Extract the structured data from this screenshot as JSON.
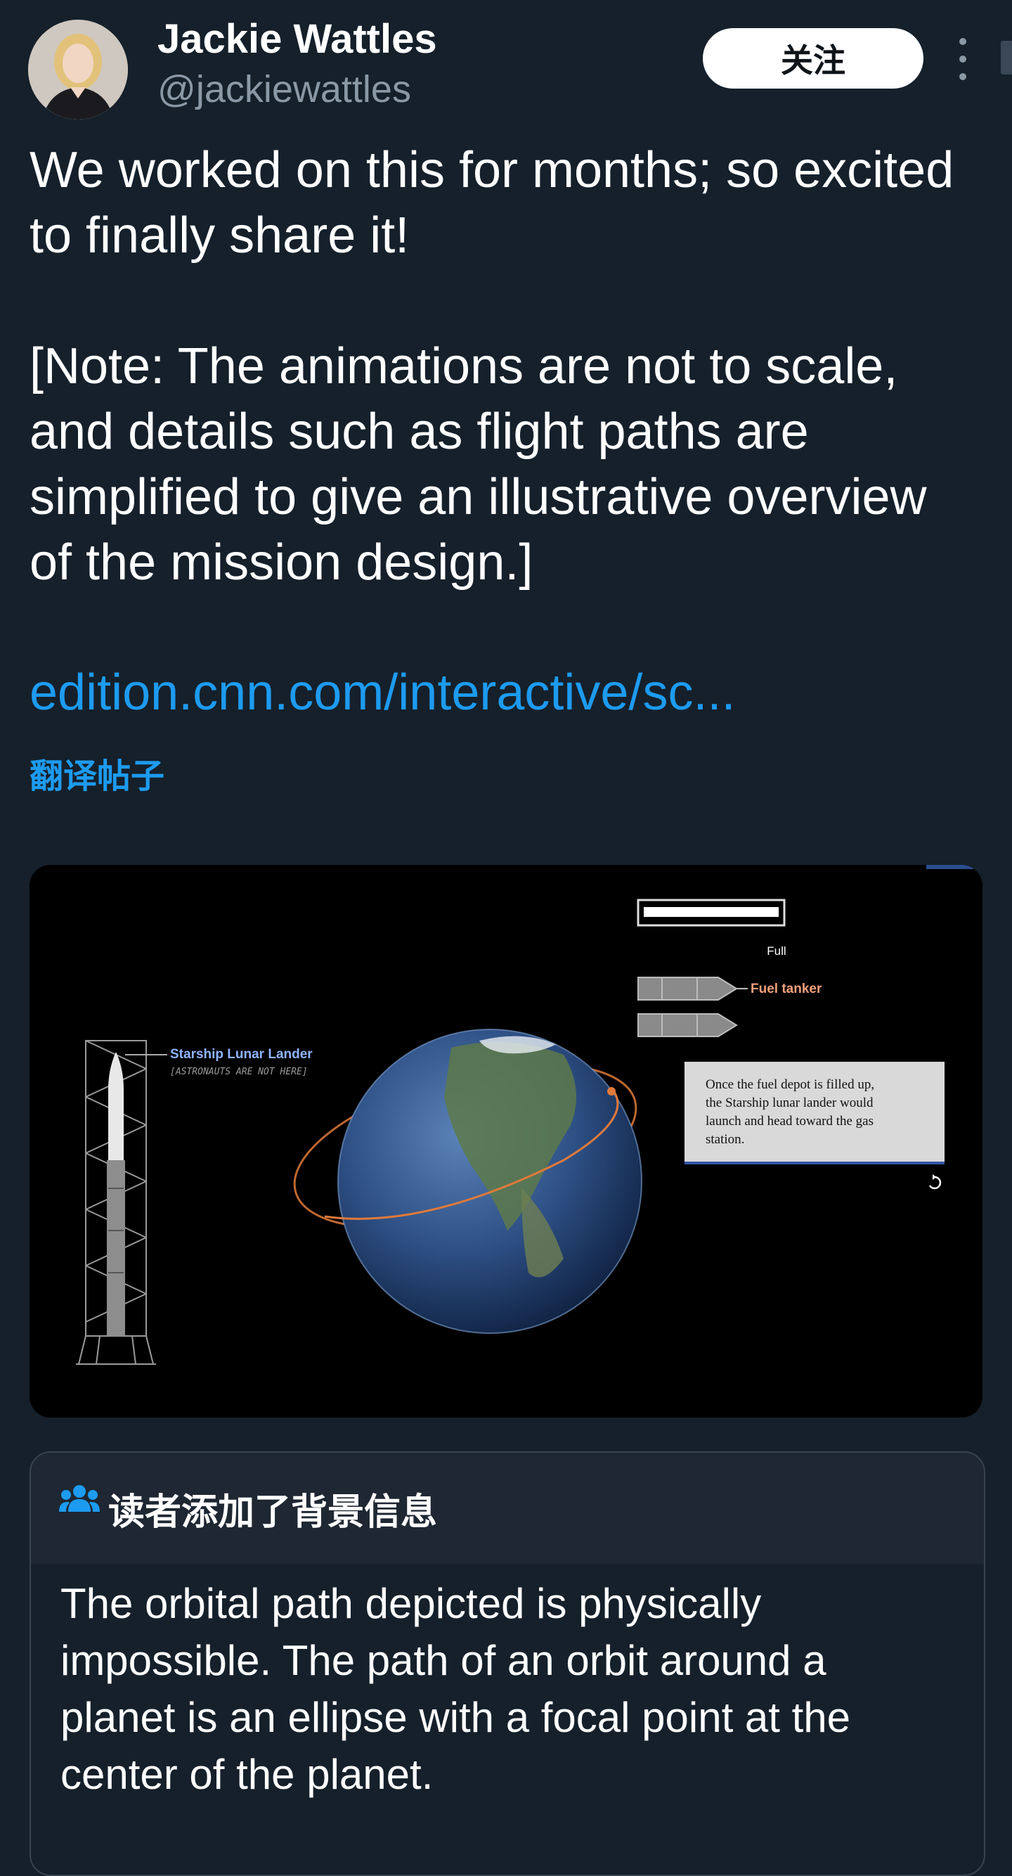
{
  "author": {
    "name": "Jackie Wattles",
    "handle": "@jackiewattles"
  },
  "follow_label": "关注",
  "tweet": {
    "lines": [
      "We worked on this for months; so excited",
      "to finally share it!",
      "[Note: The animations are not to scale,",
      "and details such as flight paths are",
      "simplified to give an illustrative overview",
      "of the mission design.]"
    ],
    "link": "edition.cnn.com/interactive/sc...",
    "translate_label": "翻译帖子"
  },
  "media": {
    "lander_label": "Starship Lunar Lander",
    "lander_sublabel": "[ASTRONAUTS ARE NOT HERE]",
    "gauge_label": "Full",
    "gauge_level": 1.0,
    "tanker_label": "Fuel tanker",
    "caption_lines": [
      "Once the fuel depot is filled up,",
      "the Starship lunar lander would",
      "launch and head toward the gas",
      "station."
    ],
    "replay_icon": "replay-icon",
    "colors": {
      "tanker_label": "#f0a07a",
      "lander_label": "#8fb4ff",
      "orbit": "#e07a3a"
    }
  },
  "community_note": {
    "title": "读者添加了背景信息",
    "icon": "people-icon",
    "lines": [
      "The orbital path depicted is physically",
      "impossible. The path of an orbit around a",
      "planet is an ellipse with a focal point at the",
      "center of the planet."
    ]
  },
  "colors": {
    "background": "#15202b",
    "link": "#1d9bf0",
    "handle": "#8b98a5",
    "card_border": "#38444d",
    "note_header": "#1e2732"
  }
}
